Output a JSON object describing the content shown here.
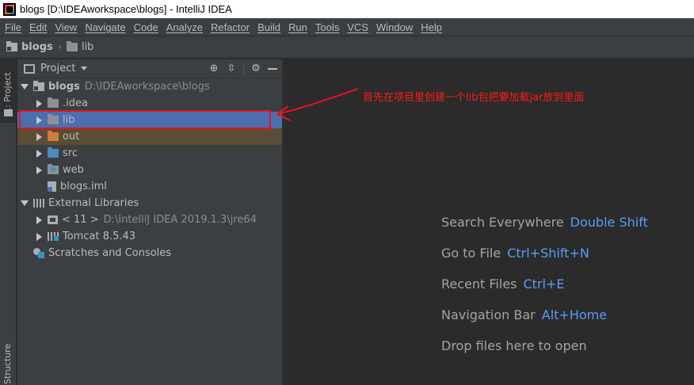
{
  "window": {
    "title": "blogs [D:\\IDEAworkspace\\blogs] - IntelliJ IDEA"
  },
  "menu": [
    "File",
    "Edit",
    "View",
    "Navigate",
    "Code",
    "Analyze",
    "Refactor",
    "Build",
    "Run",
    "Tools",
    "VCS",
    "Window",
    "Help"
  ],
  "breadcrumb": {
    "project": "blogs",
    "folder": "lib"
  },
  "toolstrip": {
    "project_tab": "1: Project",
    "structure_tab": "Structure"
  },
  "panel": {
    "title": "Project"
  },
  "tree": {
    "root_name": "blogs",
    "root_path": "D:\\IDEAworkspace\\blogs",
    "idea": ".idea",
    "lib": "lib",
    "out": "out",
    "src": "src",
    "web": "web",
    "iml": "blogs.iml",
    "external_libraries": "External Libraries",
    "jdk_name": "< 11 >",
    "jdk_path": "D:\\IntelliJ IDEA 2019.1.3\\jre64",
    "tomcat": "Tomcat 8.5.43",
    "scratches": "Scratches and Consoles"
  },
  "annotation": {
    "text": "首先在项目里创建一个lib包把要加载jar放到里面",
    "color": "#e8121c"
  },
  "hints": [
    {
      "label": "Search Everywhere",
      "shortcut": "Double Shift"
    },
    {
      "label": "Go to File",
      "shortcut": "Ctrl+Shift+N"
    },
    {
      "label": "Recent Files",
      "shortcut": "Ctrl+E"
    },
    {
      "label": "Navigation Bar",
      "shortcut": "Alt+Home"
    },
    {
      "label": "Drop files here to open",
      "shortcut": ""
    }
  ],
  "colors": {
    "selection": "#4b6eaf",
    "shortcut": "#589df6",
    "excluded": "#5b4c35"
  }
}
